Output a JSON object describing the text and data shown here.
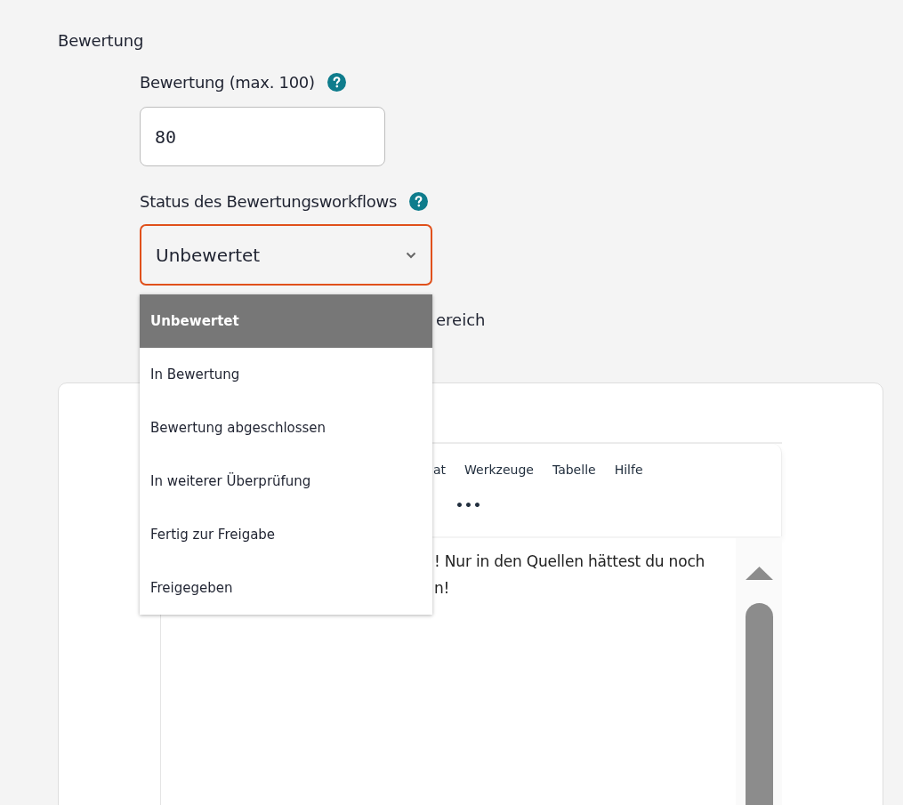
{
  "section_title": "Bewertung",
  "score": {
    "label": "Bewertung (max. 100)",
    "value": "80"
  },
  "workflow_status": {
    "label": "Status des Bewertungsworkflows",
    "value": "Unbewertet",
    "focused": true,
    "expanded": true,
    "options": [
      {
        "label": "Unbewertet",
        "selected": true
      },
      {
        "label": "In Bewertung",
        "selected": false
      },
      {
        "label": "Bewertung abgeschlossen",
        "selected": false
      },
      {
        "label": "In weiterer Überprüfung",
        "selected": false
      },
      {
        "label": "Fertig zur Freigabe",
        "selected": false
      },
      {
        "label": "Freigegeben",
        "selected": false
      }
    ]
  },
  "covered_label": "ereich",
  "editor": {
    "menubar": [
      "at",
      "Werkzeuge",
      "Tabelle",
      "Hilfe"
    ],
    "more_toolbar": "•••",
    "content_lines": [
      "! Nur in den Quellen hättest du noch",
      "n!"
    ]
  }
}
